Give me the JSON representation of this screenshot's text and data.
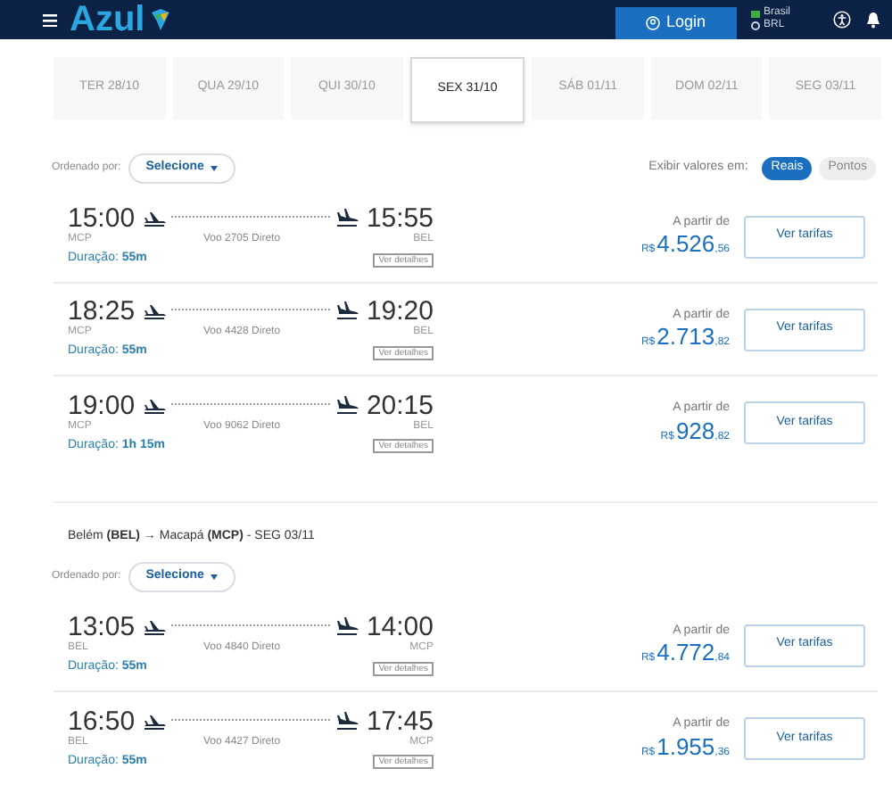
{
  "header": {
    "logo": "Azul",
    "login": "Login",
    "country": "Brasil",
    "currency": "BRL"
  },
  "dates": [
    {
      "label": "TER 28/10",
      "selected": false
    },
    {
      "label": "QUA 29/10",
      "selected": false
    },
    {
      "label": "QUI 30/10",
      "selected": false
    },
    {
      "label": "SEX 31/10",
      "selected": true
    },
    {
      "label": "SÁB 01/11",
      "selected": false
    },
    {
      "label": "DOM 02/11",
      "selected": false
    },
    {
      "label": "SEG 03/11",
      "selected": false
    }
  ],
  "display_toggle": {
    "label": "Exibir valores em:",
    "options": [
      {
        "label": "Reais",
        "selected": true
      },
      {
        "label": "Pontos",
        "selected": false
      }
    ]
  },
  "sections": [
    {
      "sort_label": "Ordenado por:",
      "sort_value": "Selecione",
      "flights": [
        {
          "dep_time": "15:00",
          "dep_airport": "MCP",
          "flight": "Voo 2705 Direto",
          "arr_time": "15:55",
          "arr_airport": "BEL",
          "duration_label": "Duração:",
          "duration": "55m",
          "details": "Ver detalhes",
          "price_label": "A partir de",
          "currency": "R$",
          "price": "4.526",
          "cents": ",56",
          "button": "Ver tarifas"
        },
        {
          "dep_time": "18:25",
          "dep_airport": "MCP",
          "flight": "Voo 4428 Direto",
          "arr_time": "19:20",
          "arr_airport": "BEL",
          "duration_label": "Duração:",
          "duration": "55m",
          "details": "Ver detalhes",
          "price_label": "A partir de",
          "currency": "R$",
          "price": "2.713",
          "cents": ",82",
          "button": "Ver tarifas"
        },
        {
          "dep_time": "19:00",
          "dep_airport": "MCP",
          "flight": "Voo 9062 Direto",
          "arr_time": "20:15",
          "arr_airport": "BEL",
          "duration_label": "Duração:",
          "duration": "1h 15m",
          "details": "Ver detalhes",
          "price_label": "A partir de",
          "currency": "R$",
          "price": "928",
          "cents": ",82",
          "button": "Ver tarifas"
        }
      ]
    },
    {
      "route": "Belém **(BEL)** → Macapá **(MCP)** - SEG 03/11",
      "sort_label": "Ordenado por:",
      "sort_value": "Selecione",
      "flights": [
        {
          "dep_time": "13:05",
          "dep_airport": "BEL",
          "flight": "Voo 4840 Direto",
          "arr_time": "14:00",
          "arr_airport": "MCP",
          "duration_label": "Duração:",
          "duration": "55m",
          "details": "Ver detalhes",
          "price_label": "A partir de",
          "currency": "R$",
          "price": "4.772",
          "cents": ",84",
          "button": "Ver tarifas"
        },
        {
          "dep_time": "16:50",
          "dep_airport": "BEL",
          "flight": "Voo 4427 Direto",
          "arr_time": "17:45",
          "arr_airport": "MCP",
          "duration_label": "Duração:",
          "duration": "55m",
          "details": "Ver detalhes",
          "price_label": "A partir de",
          "currency": "R$",
          "price": "1.955",
          "cents": ",36",
          "button": "Ver tarifas"
        }
      ]
    }
  ]
}
